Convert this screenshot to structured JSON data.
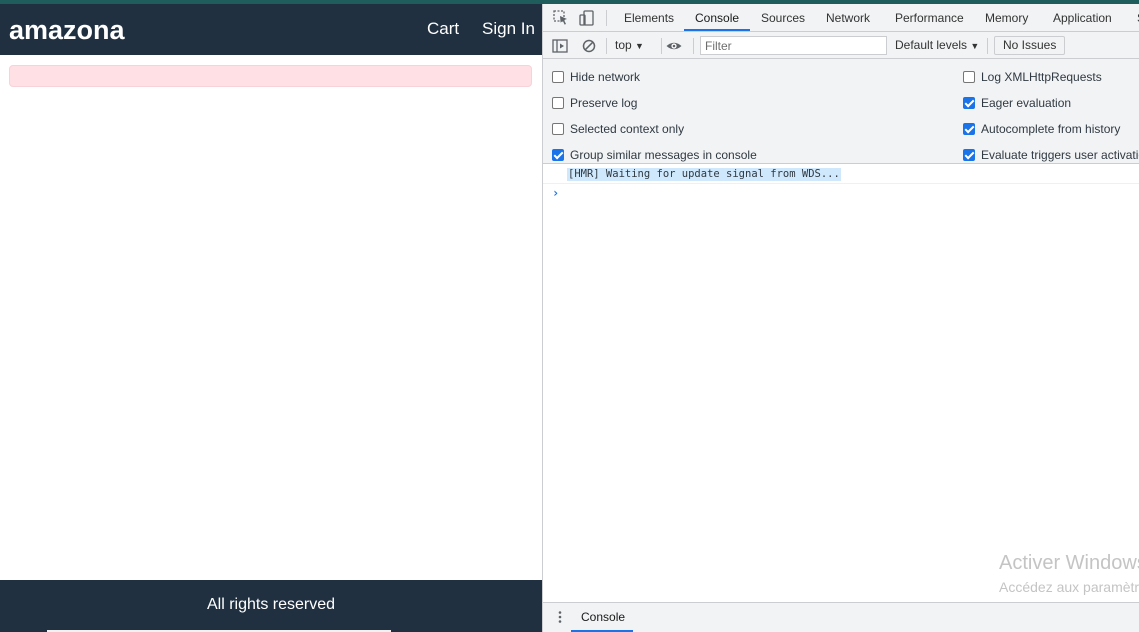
{
  "app": {
    "brand": "amazona",
    "nav": {
      "cart": "Cart",
      "sign_in": "Sign In"
    },
    "footer": "All rights reserved",
    "colors": {
      "header_bg": "#203040",
      "alert_bg": "#ffe0e4"
    }
  },
  "devtools": {
    "tabs": [
      "Elements",
      "Console",
      "Sources",
      "Network",
      "Performance",
      "Memory",
      "Application",
      "S"
    ],
    "active_tab": "Console",
    "toolbar": {
      "context": "top",
      "filter_placeholder": "Filter",
      "levels": "Default levels",
      "issues": "No Issues"
    },
    "settings": {
      "hide_network": {
        "label": "Hide network",
        "checked": false
      },
      "preserve_log": {
        "label": "Preserve log",
        "checked": false
      },
      "selected_context": {
        "label": "Selected context only",
        "checked": false
      },
      "group_similar": {
        "label": "Group similar messages in console",
        "checked": true
      },
      "log_xhr": {
        "label": "Log XMLHttpRequests",
        "checked": false
      },
      "eager_eval": {
        "label": "Eager evaluation",
        "checked": true
      },
      "autocomplete": {
        "label": "Autocomplete from history",
        "checked": true
      },
      "eval_triggers": {
        "label": "Evaluate triggers user activation",
        "checked": true
      }
    },
    "messages": [
      "[HMR] Waiting for update signal from WDS..."
    ],
    "watermark": {
      "title": "Activer Windows",
      "subtitle": "Accédez aux paramètres"
    },
    "drawer_tab": "Console",
    "accent": "#1a73e8"
  }
}
